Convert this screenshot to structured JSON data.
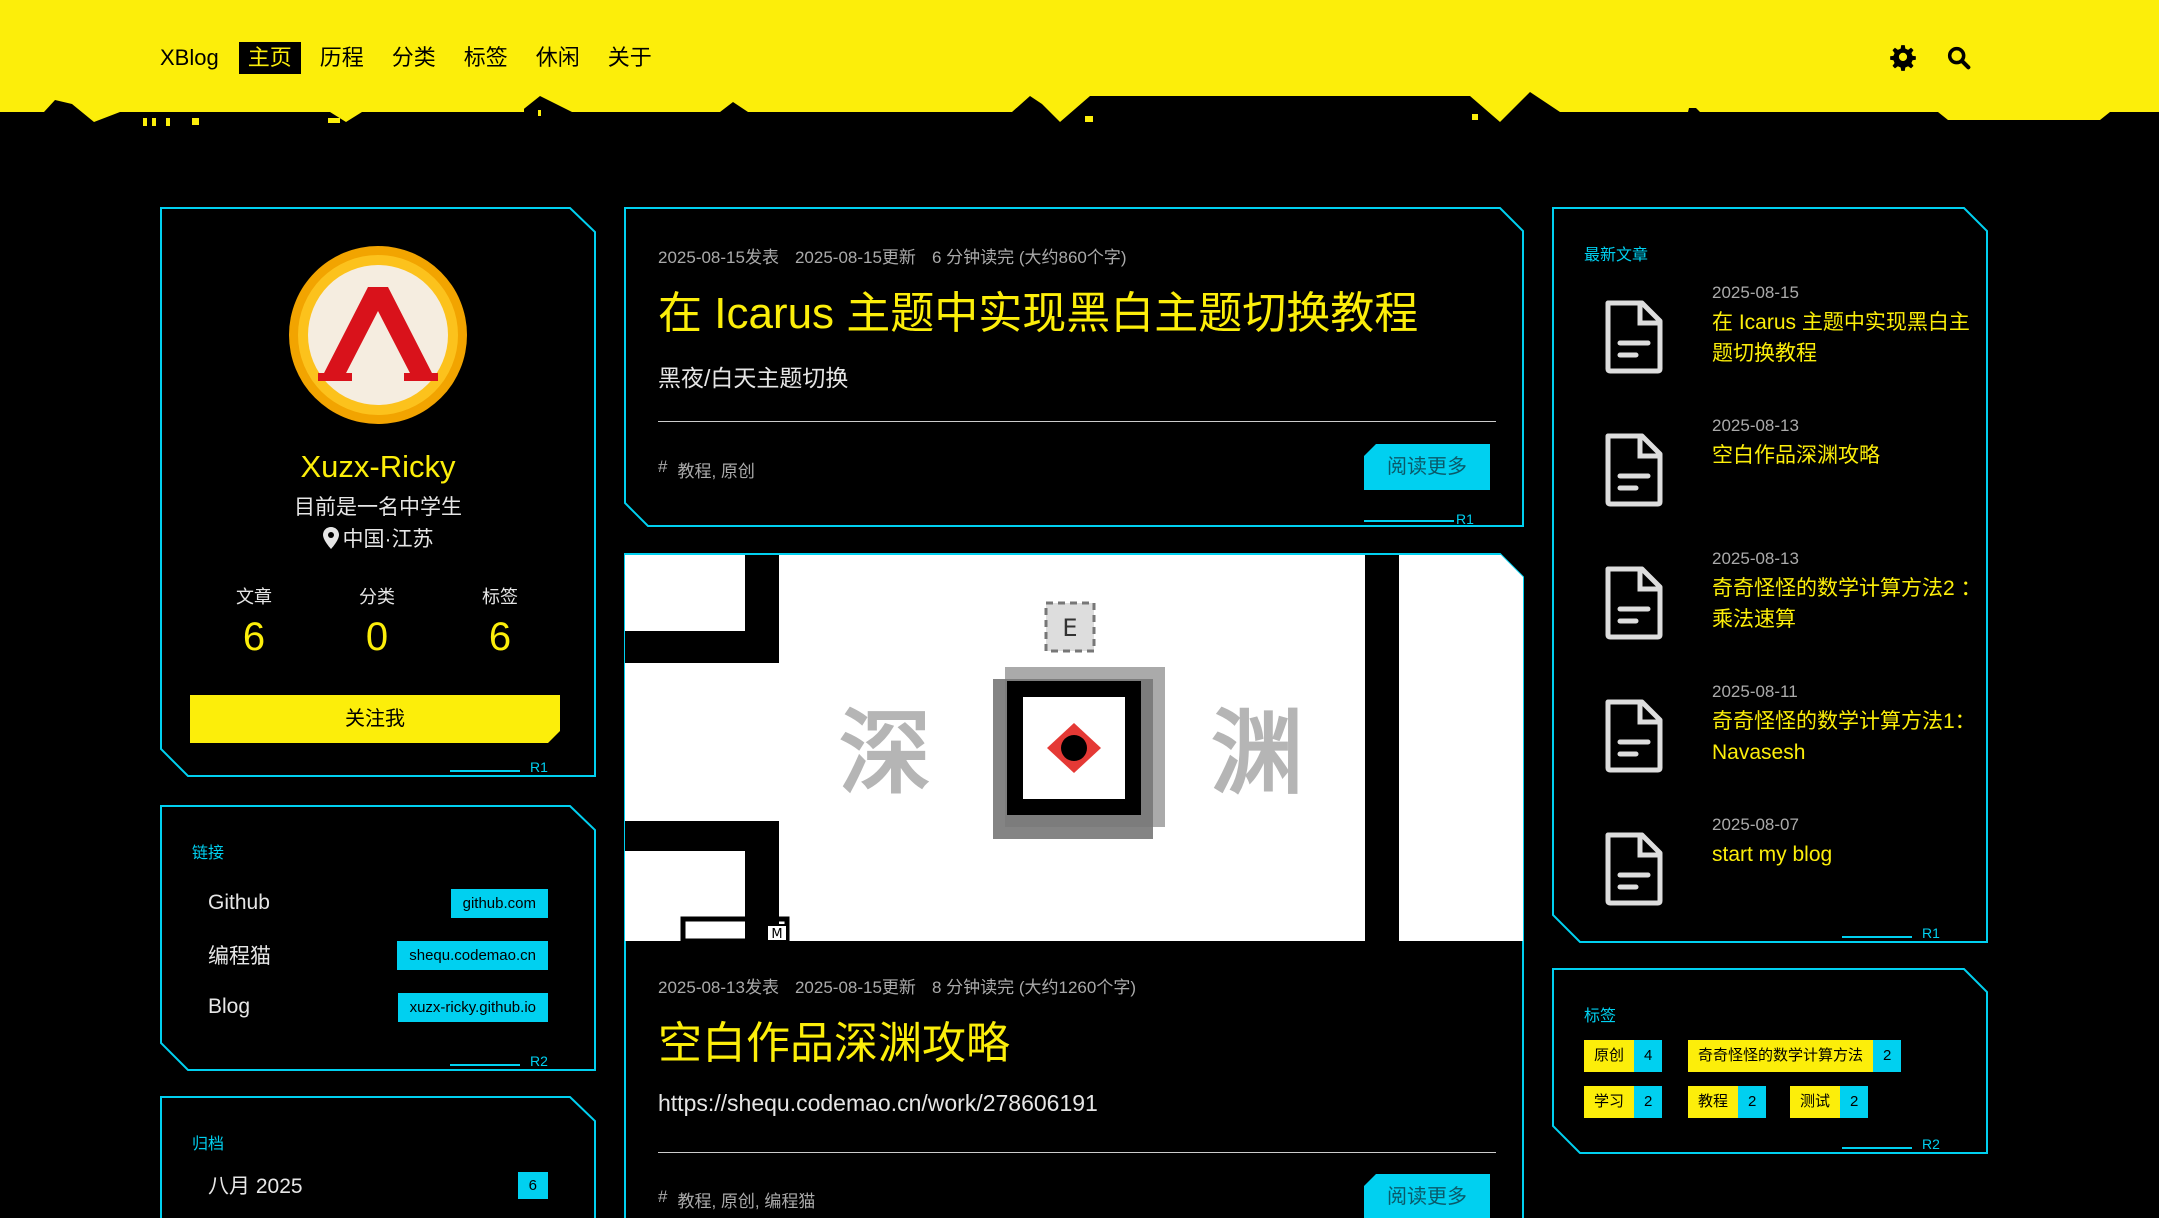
{
  "colors": {
    "accent": "#fcee0a",
    "cyan": "#00d0f0",
    "background": "#000000"
  },
  "navbar": {
    "brand": "XBlog",
    "items": [
      {
        "label": "主页",
        "active": true
      },
      {
        "label": "历程",
        "active": false
      },
      {
        "label": "分类",
        "active": false
      },
      {
        "label": "标签",
        "active": false
      },
      {
        "label": "休闲",
        "active": false
      },
      {
        "label": "关于",
        "active": false
      }
    ],
    "icons": [
      "gear-icon",
      "search-icon"
    ]
  },
  "profile": {
    "name": "Xuzx-Ricky",
    "bio": "目前是一名中学生",
    "location": "中国·江苏",
    "stats": [
      {
        "label": "文章",
        "value": "6"
      },
      {
        "label": "分类",
        "value": "0"
      },
      {
        "label": "标签",
        "value": "6"
      }
    ],
    "follow_label": "关注我",
    "corner_tag": "R1"
  },
  "links": {
    "heading": "链接",
    "corner_tag": "R2",
    "items": [
      {
        "name": "Github",
        "badge": "github.com"
      },
      {
        "name": "编程猫",
        "badge": "shequ.codemao.cn"
      },
      {
        "name": "Blog",
        "badge": "xuzx-ricky.github.io"
      }
    ]
  },
  "archive": {
    "heading": "归档",
    "items": [
      {
        "name": "八月 2025",
        "count": "6"
      }
    ]
  },
  "posts": [
    {
      "published": "2025-08-15发表",
      "updated": "2025-08-15更新",
      "reading": "6 分钟读完 (大约860个字)",
      "title": "在 Icarus 主题中实现黑白主题切换教程",
      "excerpt": "黑夜/白天主题切换",
      "tags_prefix": "#",
      "tags": "教程, 原创",
      "read_more": "阅读更多",
      "corner_tag": "R1"
    },
    {
      "cover": {
        "left_char": "深",
        "right_char": "渊",
        "marker_e": "E",
        "marker_m": "M"
      },
      "published": "2025-08-13发表",
      "updated": "2025-08-15更新",
      "reading": "8 分钟读完 (大约1260个字)",
      "title": "空白作品深渊攻略",
      "excerpt": "https://shequ.codemao.cn/work/278606191",
      "tags_prefix": "#",
      "tags": "教程, 原创, 编程猫",
      "read_more": "阅读更多"
    }
  ],
  "recent": {
    "heading": "最新文章",
    "corner_tag": "R1",
    "items": [
      {
        "date": "2025-08-15",
        "title": "在 Icarus 主题中实现黑白主题切换教程"
      },
      {
        "date": "2025-08-13",
        "title": "空白作品深渊攻略"
      },
      {
        "date": "2025-08-13",
        "title": "奇奇怪怪的数学计算方法2 ： 乘法速算"
      },
      {
        "date": "2025-08-11",
        "title": "奇奇怪怪的数学计算方法1：Navasesh"
      },
      {
        "date": "2025-08-07",
        "title": "start my blog"
      }
    ]
  },
  "tags": {
    "heading": "标签",
    "corner_tag": "R2",
    "items": [
      {
        "name": "原创",
        "count": "4"
      },
      {
        "name": "奇奇怪怪的数学计算方法",
        "count": "2"
      },
      {
        "name": "学习",
        "count": "2"
      },
      {
        "name": "教程",
        "count": "2"
      },
      {
        "name": "测试",
        "count": "2"
      }
    ]
  }
}
